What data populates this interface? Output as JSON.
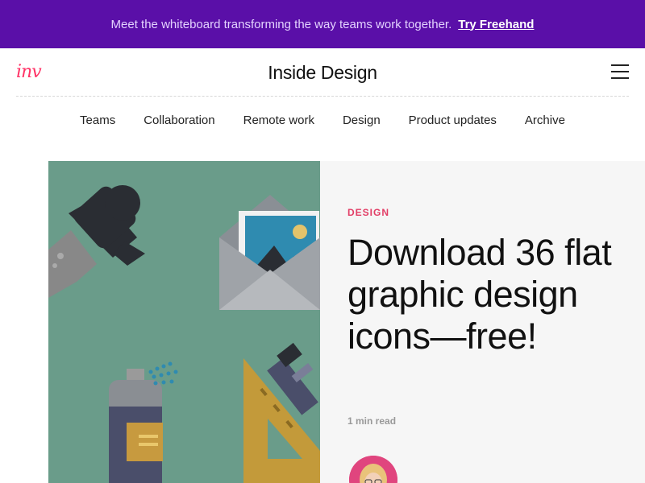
{
  "promo": {
    "text": "Meet the whiteboard transforming the way teams work together.",
    "link_label": "Try Freehand"
  },
  "header": {
    "logo": "inv",
    "title": "Inside Design",
    "menu_icon": "hamburger-menu-icon"
  },
  "nav": {
    "items": [
      "Teams",
      "Collaboration",
      "Remote work",
      "Design",
      "Product updates",
      "Archive"
    ]
  },
  "article": {
    "category": "DESIGN",
    "title": "Download 36 flat graphic design icons—free!",
    "read_time": "1 min read",
    "hero_icons": [
      "marker-icon",
      "envelope-photo-icon",
      "spray-can-icon",
      "triangle-ruler-icon",
      "pencil-icon"
    ]
  },
  "colors": {
    "promo_bg": "#5a0fa8",
    "brand_pink": "#ff3366",
    "category_red": "#e23e66",
    "hero_green": "#6a9c8a",
    "card_bg": "#f6f6f6"
  }
}
